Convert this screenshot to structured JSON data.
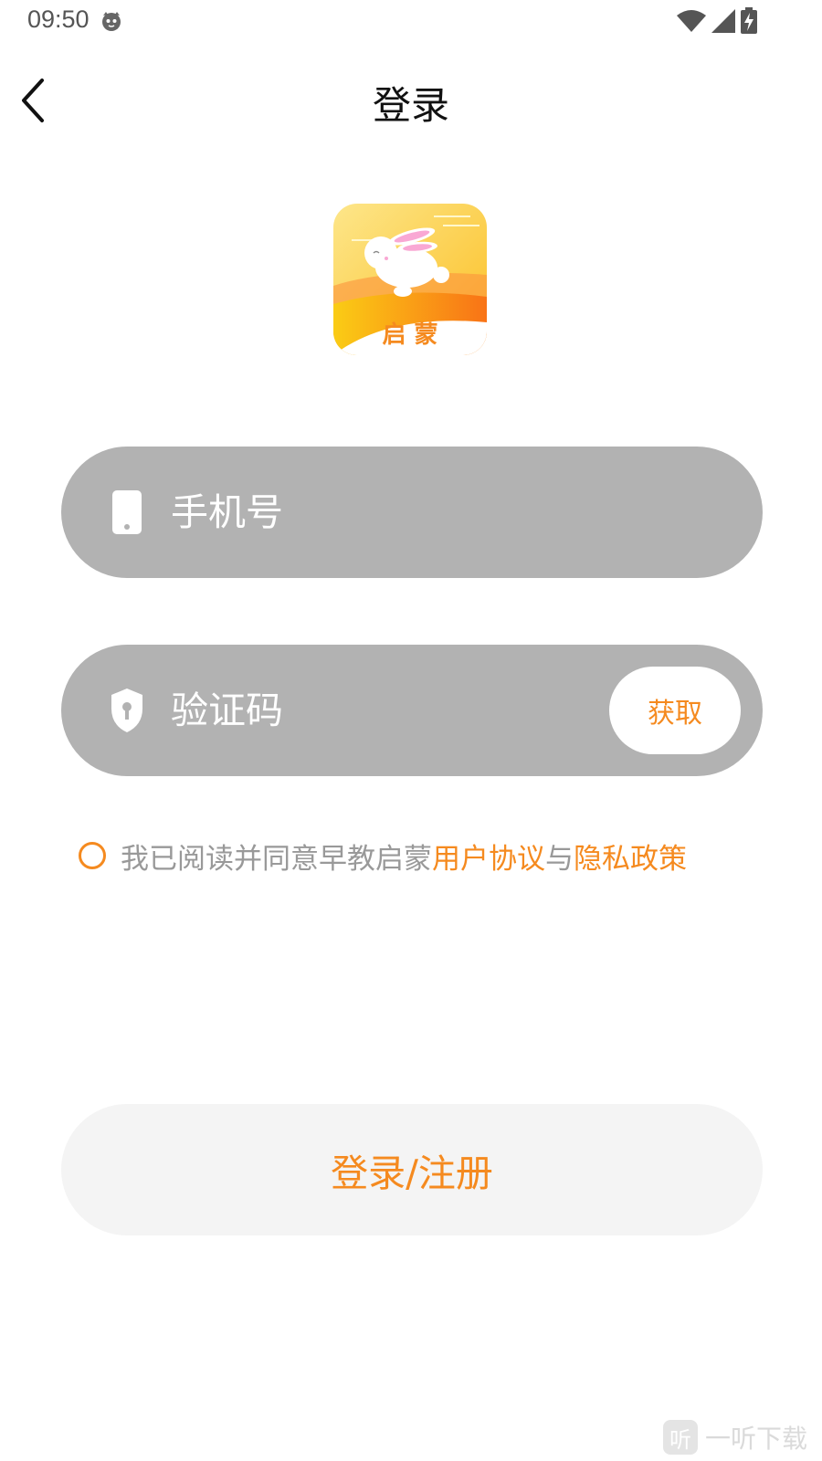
{
  "status_bar": {
    "time": "09:50",
    "icons": [
      "cat-face-icon",
      "wifi-icon",
      "cell-signal-icon",
      "battery-charging-icon"
    ]
  },
  "header": {
    "title": "登录",
    "back_icon": "chevron-left-icon"
  },
  "logo": {
    "text": "启 蒙",
    "colors": {
      "sky": "#fcd34d",
      "sun": "#fbbf24",
      "hill": "#f97316",
      "rabbit": "#ffffff",
      "text": "#f58a1f"
    }
  },
  "phone_field": {
    "icon": "phone-icon",
    "placeholder": "手机号",
    "value": ""
  },
  "code_field": {
    "icon": "shield-lock-icon",
    "placeholder": "验证码",
    "value": "",
    "get_code_label": "获取"
  },
  "agreement": {
    "checked": false,
    "prefix": "我已阅读并同意早教启蒙",
    "user_agreement": "用户协议",
    "conjunction": "与",
    "privacy_policy": "隐私政策"
  },
  "submit": {
    "label": "登录/注册"
  },
  "watermark": {
    "badge": "听",
    "text": "一听下载"
  },
  "colors": {
    "accent": "#f58a1f",
    "field_bg": "#b2b2b2",
    "button_bg": "#f4f4f4",
    "muted_text": "#999999"
  }
}
